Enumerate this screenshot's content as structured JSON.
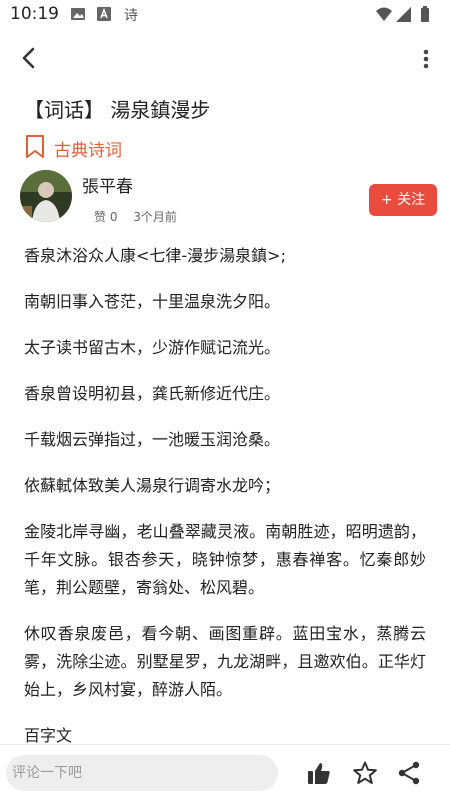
{
  "status": {
    "time": "10:19",
    "app_label": "诗",
    "icons_left": [
      "image-icon",
      "font-icon"
    ],
    "icons_right": [
      "wifi-icon",
      "signal-icon",
      "battery-icon"
    ]
  },
  "toolbar": {
    "back_icon": "back-arrow-icon",
    "more_icon": "more-vertical-icon"
  },
  "article": {
    "title": "【词话】 湯泉鎮漫步",
    "category": "古典诗词",
    "category_icon": "bookmark-icon",
    "author": {
      "name": "張平春",
      "likes": "赞 0",
      "time": "3个月前"
    },
    "follow_label": "+ 关注",
    "paragraphs": [
      "香泉沐浴众人康<七律-漫步湯泉鎮>;",
      "南朝旧事入苍茫，十里温泉洗夕阳。",
      "太子读书留古木，少游作赋记流光。",
      "香泉曾设明初县，龚氏新修近代庄。",
      "千载烟云弹指过，一池暖玉润沧桑。",
      "依蘇軾体致美人湯泉行调寄水龙吟；",
      "金陵北岸寻幽，老山叠翠藏灵液。南朝胜迹，昭明遗韵，千年文脉。银杏参天，晓钟惊梦，惠春禅客。忆秦郎妙笔，荆公题壁，寄翁处、松风碧。",
      "休叹香泉废邑，看今朝、画图重辟。蓝田宝水，蒸腾云雾，洗除尘迹。别墅星罗，九龙湖畔，且邀欢伯。正华灯始上，乡风村宴，醉游人陌。",
      "百字文"
    ]
  },
  "bottom": {
    "comment_placeholder": "评论一下吧",
    "icons": [
      "like-icon",
      "star-icon",
      "share-icon"
    ]
  },
  "colors": {
    "accent": "#e0603a",
    "follow_bg": "#e94b3c",
    "input_bg": "#eeeeee"
  }
}
